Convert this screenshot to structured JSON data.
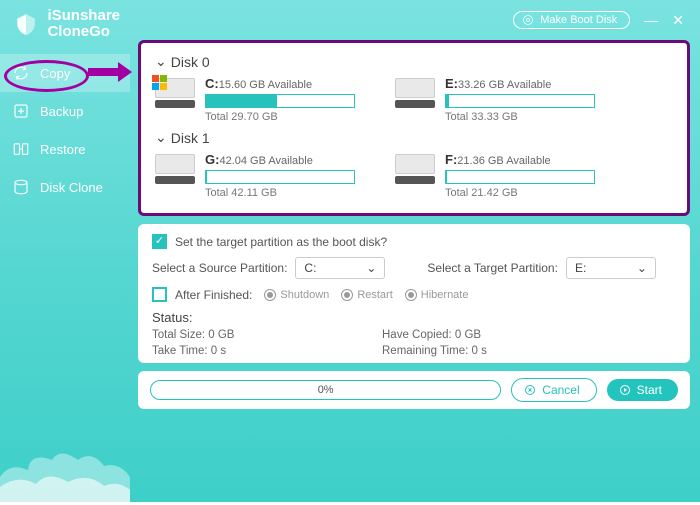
{
  "brand": {
    "line1": "iSunshare",
    "line2": "CloneGo"
  },
  "titlebar": {
    "boot_btn": "Make Boot Disk"
  },
  "nav": {
    "items": [
      {
        "key": "copy",
        "label": "Copy"
      },
      {
        "key": "backup",
        "label": "Backup"
      },
      {
        "key": "restore",
        "label": "Restore"
      },
      {
        "key": "diskclone",
        "label": "Disk Clone"
      }
    ]
  },
  "disks": [
    {
      "name": "Disk 0",
      "partitions": [
        {
          "letter": "C:",
          "available": "15.60 GB Available",
          "total": "Total 29.70 GB",
          "fill_pct": 48,
          "win": true
        },
        {
          "letter": "E:",
          "available": "33.26 GB Available",
          "total": "Total 33.33 GB",
          "fill_pct": 2,
          "win": false
        }
      ]
    },
    {
      "name": "Disk 1",
      "partitions": [
        {
          "letter": "G:",
          "available": "42.04 GB Available",
          "total": "Total 42.11 GB",
          "fill_pct": 1,
          "win": false
        },
        {
          "letter": "F:",
          "available": "21.36 GB Available",
          "total": "Total 21.42 GB",
          "fill_pct": 1,
          "win": false
        }
      ]
    }
  ],
  "opts": {
    "boot_chk_label": "Set the target partition as the boot disk?",
    "boot_chk_on": true,
    "src_label": "Select a Source Partition:",
    "src_value": "C:",
    "tgt_label": "Select a Target Partition:",
    "tgt_value": "E:",
    "after_chk_label": "After Finished:",
    "after_chk_on": false,
    "radios": [
      {
        "label": "Shutdown",
        "on": true
      },
      {
        "label": "Restart",
        "on": true
      },
      {
        "label": "Hibernate",
        "on": true
      }
    ]
  },
  "status": {
    "title": "Status:",
    "total_size": "Total Size: 0 GB",
    "take_time": "Take Time: 0 s",
    "have_copied": "Have Copied: 0 GB",
    "remaining": "Remaining Time: 0 s"
  },
  "bottom": {
    "progress_text": "0%",
    "cancel": "Cancel",
    "start": "Start"
  }
}
